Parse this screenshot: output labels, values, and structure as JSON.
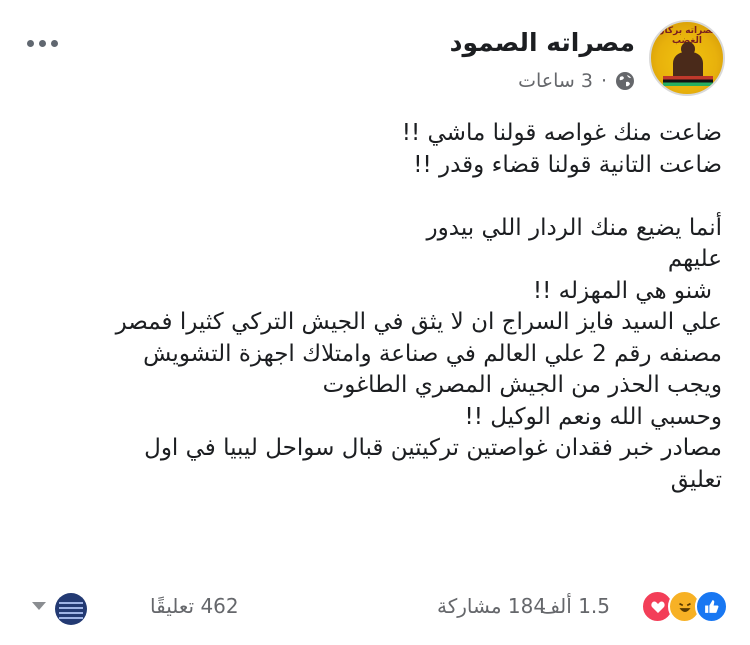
{
  "page": {
    "name": "مصراته الصمود",
    "avatar_text": "ﻣﺼﺮﺍﺗﻪ ﺑﺮﻛﺎﻥ ﺍﻟﻐﻀﺐ",
    "time": "3 ساعات",
    "separator": "·",
    "privacy_icon": "globe-icon"
  },
  "post": {
    "lines": [
      "ضاعت منك غواصه قولنا ماشي !!",
      "ضاعت التانية قولنا قضاء وقدر !!",
      "",
      "أنما يضيع منك الردار اللي بيدور",
      "عليهم",
      "شنو هي المهزله !!",
      "علي السيد فايز السراج ان لا يثق في الجيش التركي كثيرا فمصر",
      "مصنفه رقم 2 علي العالم في صناعة وامتلاك اجهزة التشويش",
      "ويجب الحذر من الجيش المصري الطاغوت",
      "وحسبي الله ونعم الوكيل !!",
      "مصادر خبر فقدان غواصتين تركيتين قبال سواحل ليبيا في اول",
      "تعليق"
    ]
  },
  "footer": {
    "reactions_count": "1.5 ألف",
    "shares": "184 مشاركة",
    "comments": "462 تعليقًا",
    "reaction_icons": [
      "like-icon",
      "haha-icon",
      "love-icon"
    ]
  },
  "colors": {
    "text": "#1c1e21",
    "secondary": "#65676b",
    "like": "#1877f2",
    "haha": "#f7b125",
    "love": "#f33e58"
  }
}
